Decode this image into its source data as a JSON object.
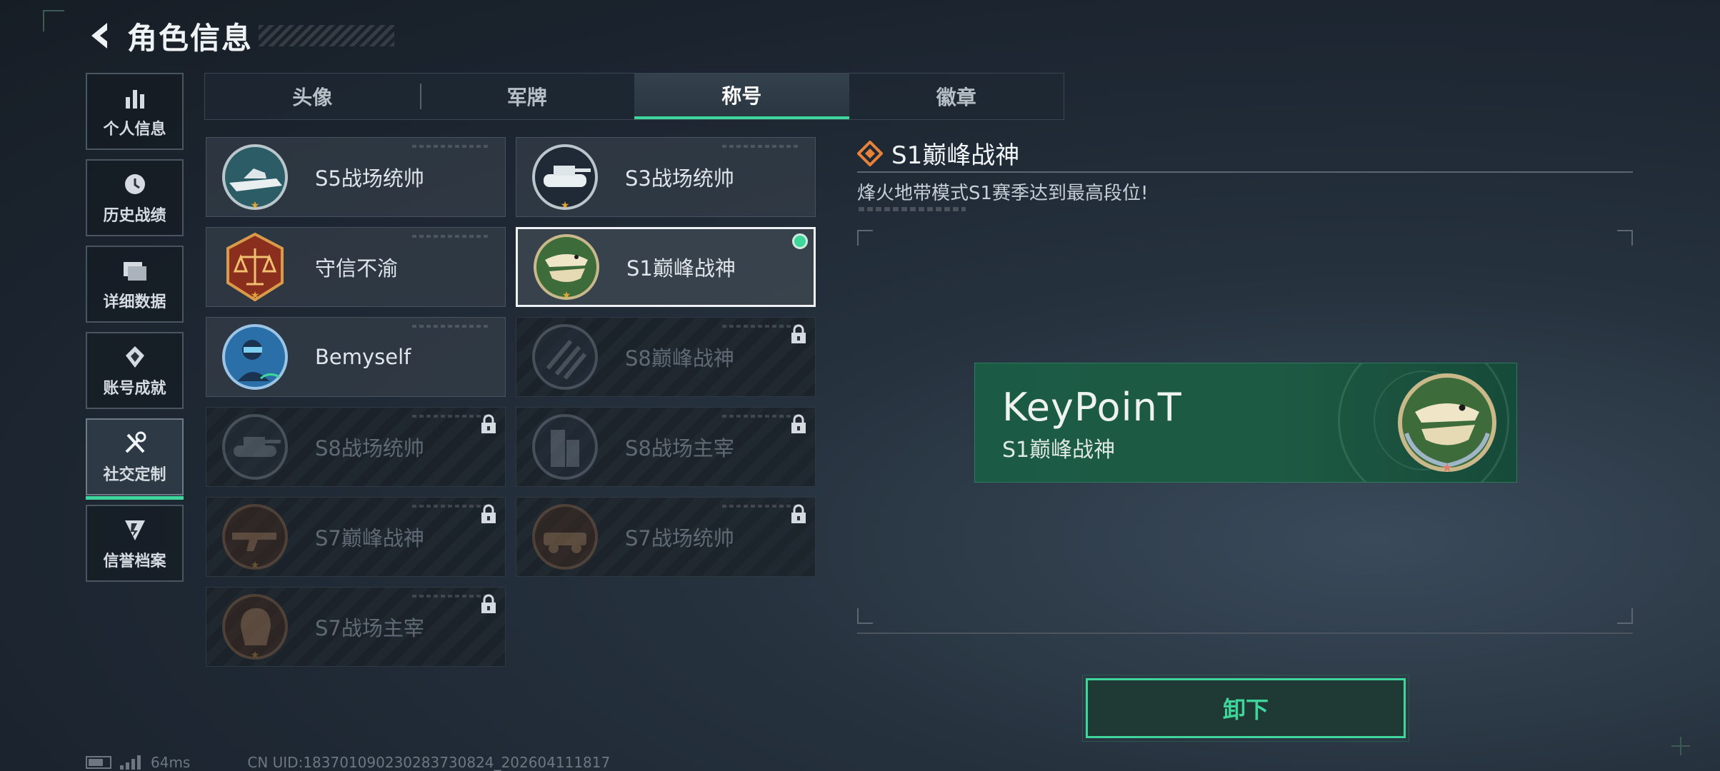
{
  "header": {
    "title": "角色信息"
  },
  "sidenav": [
    {
      "label": "个人信息",
      "icon": "bar-chart-icon",
      "active": false
    },
    {
      "label": "历史战绩",
      "icon": "clock-icon",
      "active": false
    },
    {
      "label": "详细数据",
      "icon": "folder-icon",
      "active": false
    },
    {
      "label": "账号成就",
      "icon": "achievement-icon",
      "active": false
    },
    {
      "label": "社交定制",
      "icon": "tools-icon",
      "active": true
    },
    {
      "label": "信誉档案",
      "icon": "shield-icon",
      "active": false
    }
  ],
  "tabs": [
    {
      "label": "头像",
      "active": false
    },
    {
      "label": "军牌",
      "active": false
    },
    {
      "label": "称号",
      "active": true
    },
    {
      "label": "徽章",
      "active": false
    }
  ],
  "titles": [
    {
      "name": "S5战场统帅",
      "emblem": "boat-emblem-icon",
      "locked": false,
      "selected": false
    },
    {
      "name": "S3战场统帅",
      "emblem": "tank-emblem-icon",
      "locked": false,
      "selected": false
    },
    {
      "name": "守信不渝",
      "emblem": "scales-emblem-icon",
      "locked": false,
      "selected": false
    },
    {
      "name": "S1巅峰战神",
      "emblem": "crocodile-emblem-icon",
      "locked": false,
      "selected": true
    },
    {
      "name": "Bemyself",
      "emblem": "soldier-emblem-icon",
      "locked": false,
      "selected": false
    },
    {
      "name": "S8巅峰战神",
      "emblem": "stripes-emblem-icon",
      "locked": true,
      "selected": false
    },
    {
      "name": "S8战场统帅",
      "emblem": "tank-emblem-icon",
      "locked": true,
      "selected": false
    },
    {
      "name": "S8战场主宰",
      "emblem": "building-emblem-icon",
      "locked": true,
      "selected": false
    },
    {
      "name": "S7巅峰战神",
      "emblem": "gun-emblem-icon",
      "locked": true,
      "selected": false
    },
    {
      "name": "S7战场统帅",
      "emblem": "vehicle-emblem-icon",
      "locked": true,
      "selected": false
    },
    {
      "name": "S7战场主宰",
      "emblem": "helmet-emblem-icon",
      "locked": true,
      "selected": false
    }
  ],
  "detail": {
    "name": "S1巅峰战神",
    "description": "烽火地带模式S1赛季达到最高段位!",
    "player_name": "KeyPoinT",
    "plate_title": "S1巅峰战神",
    "unequip_label": "卸下"
  },
  "status": {
    "ping": "64ms",
    "uid": "CN UID:183701090230283730824_202604111817"
  },
  "colors": {
    "accent": "#3ed69a",
    "plate": "#1b5b45",
    "star": "#e2a73a"
  }
}
